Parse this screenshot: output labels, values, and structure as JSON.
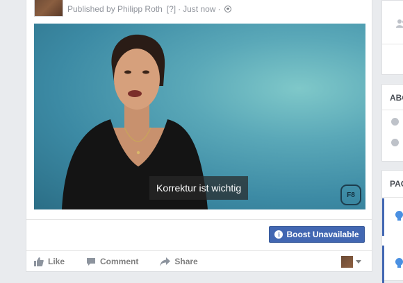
{
  "post": {
    "published_by": "Published by Philipp Roth",
    "help_marker": "[?]",
    "dot": "·",
    "time": "Just now",
    "dot2": "·",
    "privacy_icon": "globe-icon"
  },
  "video": {
    "caption": "Korrektur ist wichtig",
    "watermark": "F8"
  },
  "boost": {
    "icon": "info-icon",
    "info_glyph": "i",
    "label": "Boost Unavailable"
  },
  "actions": {
    "like": "Like",
    "comment": "Comment",
    "share": "Share"
  },
  "right_panel": {
    "about_heading": "ABO",
    "pages_heading": "PAG"
  },
  "colors": {
    "accent": "#4267b2",
    "background": "#e9ebee"
  }
}
